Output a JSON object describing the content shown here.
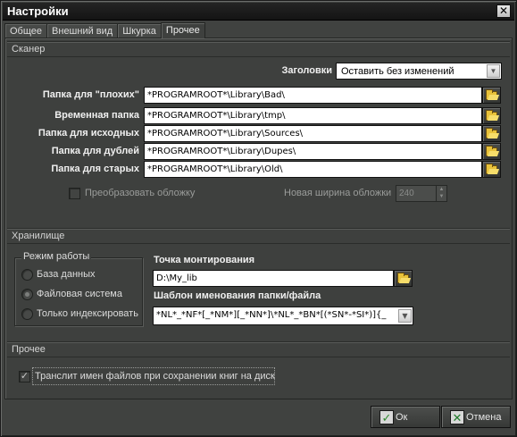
{
  "window": {
    "title": "Настройки",
    "close_glyph": "✕"
  },
  "tabs": [
    {
      "label": "Общее"
    },
    {
      "label": "Внешний вид"
    },
    {
      "label": "Шкурка"
    },
    {
      "label": "Прочее"
    }
  ],
  "scanner": {
    "header": "Сканер",
    "headings_label": "Заголовки",
    "headings_value": "Оставить без изменений",
    "folders": [
      {
        "label": "Папка для \"плохих\"",
        "value": "*PROGRAMROOT*\\Library\\Bad\\"
      },
      {
        "label": "Временная папка",
        "value": "*PROGRAMROOT*\\Library\\tmp\\"
      },
      {
        "label": "Папка для исходных",
        "value": "*PROGRAMROOT*\\Library\\Sources\\"
      },
      {
        "label": "Папка для дублей",
        "value": "*PROGRAMROOT*\\Library\\Dupes\\"
      },
      {
        "label": "Папка для старых",
        "value": "*PROGRAMROOT*\\Library\\Old\\"
      }
    ],
    "convert_cover_label": "Преобразовать обложку",
    "convert_cover_checked": false,
    "new_width_label": "Новая ширина обложки",
    "new_width_value": "240"
  },
  "storage": {
    "header": "Хранилище",
    "mode_title": "Режим работы",
    "modes": [
      {
        "label": "База данных",
        "selected": false
      },
      {
        "label": "Файловая система",
        "selected": true
      },
      {
        "label": "Только индексировать",
        "selected": false
      }
    ],
    "mount_label": "Точка монтирования",
    "mount_value": "D:\\My_lib",
    "template_label": "Шаблон именования папки/файла",
    "template_value": "*NL*_*NF*[_*NM*][_*NN*]\\*NL*_*BN*[(*SN*-*SI*)]{_"
  },
  "other": {
    "header": "Прочее",
    "translit_label": "Транслит имен файлов при сохранении книг на диск",
    "translit_checked": true
  },
  "buttons": {
    "ok_label": "Ок",
    "cancel_label": "Отмена"
  },
  "icons": {
    "folder": "folder-open-icon",
    "ok": "checkmark-icon",
    "cancel": "cross-icon"
  },
  "colors": {
    "titlebar": "#1c1c1c",
    "window_bg": "#404240",
    "ok_icon": "#2f8a2f",
    "cancel_icon": "#1f7a2a"
  }
}
